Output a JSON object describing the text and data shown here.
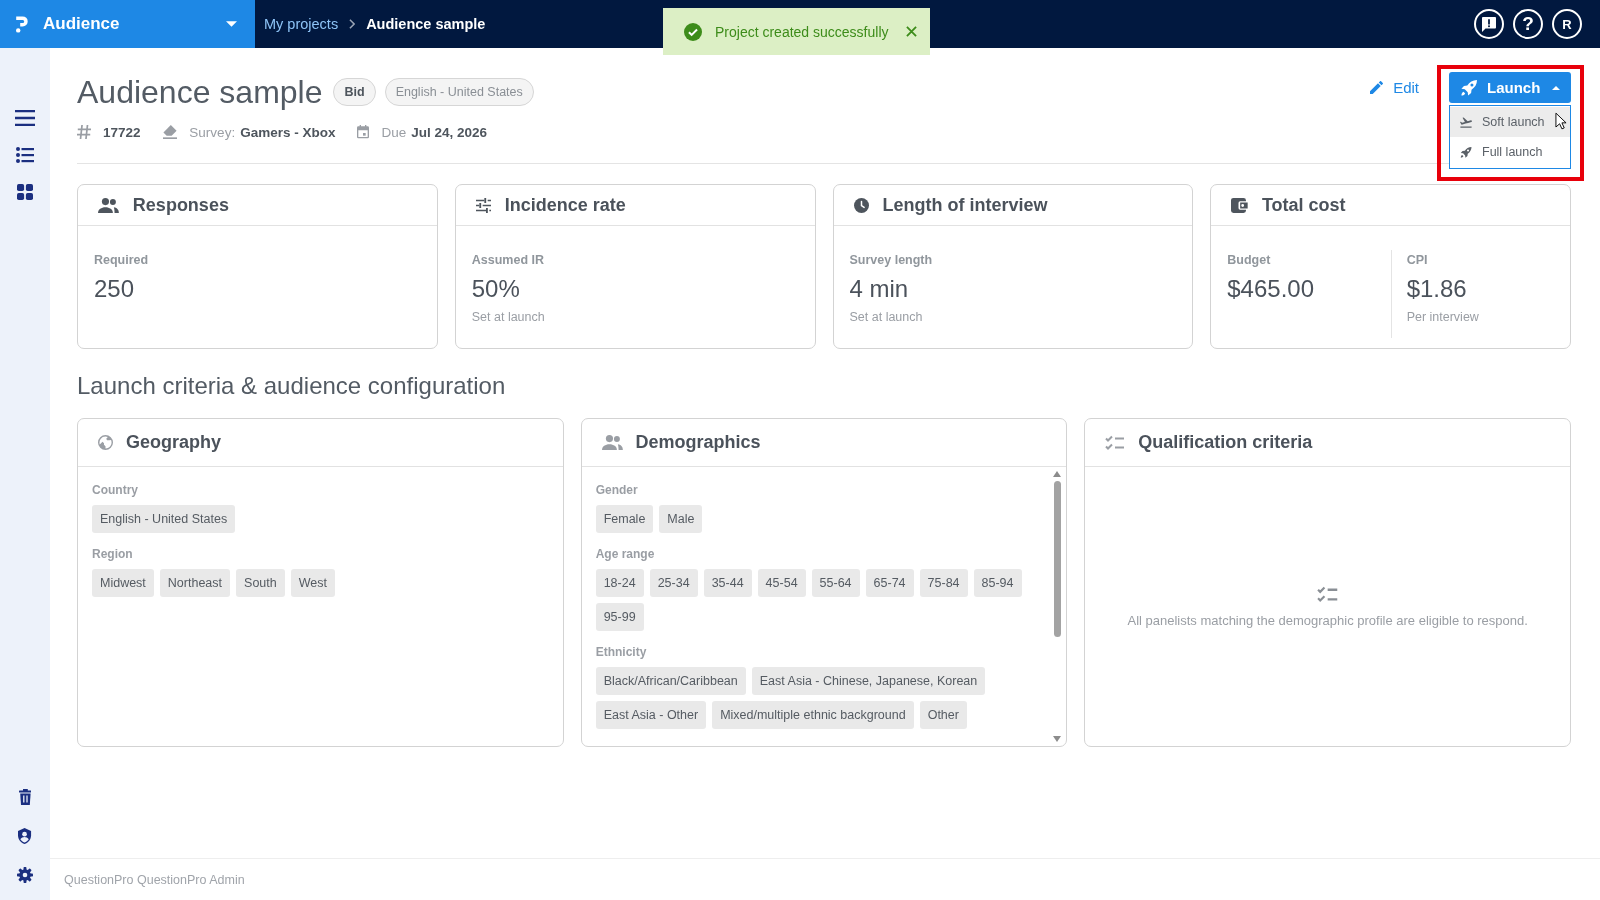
{
  "top_bar": {
    "app_name": "Audience",
    "breadcrumb": [
      {
        "label": "My projects",
        "kind": "link"
      },
      {
        "label": "Audience sample",
        "kind": "current"
      }
    ],
    "help_label": "?",
    "avatar_initial": "R"
  },
  "toast": {
    "kind": "success",
    "message": "Project created successfully"
  },
  "project": {
    "title": "Audience sample",
    "tags": [
      {
        "label": "Bid",
        "kind": "status"
      },
      {
        "label": "English - United States",
        "kind": "language"
      }
    ],
    "meta": [
      {
        "kind": "id",
        "value": "17722"
      },
      {
        "kind": "survey",
        "label": "Survey:",
        "value": "Gamers - Xbox"
      },
      {
        "kind": "due",
        "label": "Due",
        "value": "Jul 24, 2026"
      }
    ]
  },
  "actions": {
    "edit_label": "Edit",
    "launch": {
      "label": "Launch",
      "expanded": true,
      "highlighted": true,
      "menu": [
        {
          "label": "Soft launch",
          "kind": "soft",
          "hovered": true
        },
        {
          "label": "Full launch",
          "kind": "full",
          "hovered": false
        }
      ]
    }
  },
  "summary_cards": [
    {
      "title": "Responses",
      "metrics": [
        {
          "label": "Required",
          "value": "250"
        }
      ]
    },
    {
      "title": "Incidence rate",
      "metrics": [
        {
          "label": "Assumed IR",
          "value": "50%",
          "note": "Set at launch"
        }
      ]
    },
    {
      "title": "Length of interview",
      "metrics": [
        {
          "label": "Survey length",
          "value": "4 min",
          "note": "Set at launch"
        }
      ]
    },
    {
      "title": "Total cost",
      "metrics": [
        {
          "label": "Budget",
          "value": "$465.00"
        },
        {
          "label": "CPI",
          "value": "$1.86",
          "note": "Per interview"
        }
      ]
    }
  ],
  "section_title": "Launch criteria & audience configuration",
  "panels": [
    {
      "title": "Geography",
      "kind": "chips",
      "scrollable": false,
      "groups": [
        {
          "label": "Country",
          "chips": [
            "English - United States"
          ]
        },
        {
          "label": "Region",
          "chips": [
            "Midwest",
            "Northeast",
            "South",
            "West"
          ]
        }
      ]
    },
    {
      "title": "Demographics",
      "kind": "chips",
      "scrollable": true,
      "groups": [
        {
          "label": "Gender",
          "chips": [
            "Female",
            "Male"
          ]
        },
        {
          "label": "Age range",
          "chips": [
            "18-24",
            "25-34",
            "35-44",
            "45-54",
            "55-64",
            "65-74",
            "75-84",
            "85-94",
            "95-99"
          ]
        },
        {
          "label": "Ethnicity",
          "chips": [
            "Black/African/Caribbean",
            "East Asia - Chinese, Japanese, Korean",
            "East Asia - Other",
            "Mixed/multiple ethnic background",
            "Other"
          ]
        }
      ]
    },
    {
      "title": "Qualification criteria",
      "kind": "empty",
      "scrollable": false,
      "message": "All panelists matching the demographic profile are eligible to respond."
    }
  ],
  "footer": "QuestionPro QuestionPro Admin"
}
